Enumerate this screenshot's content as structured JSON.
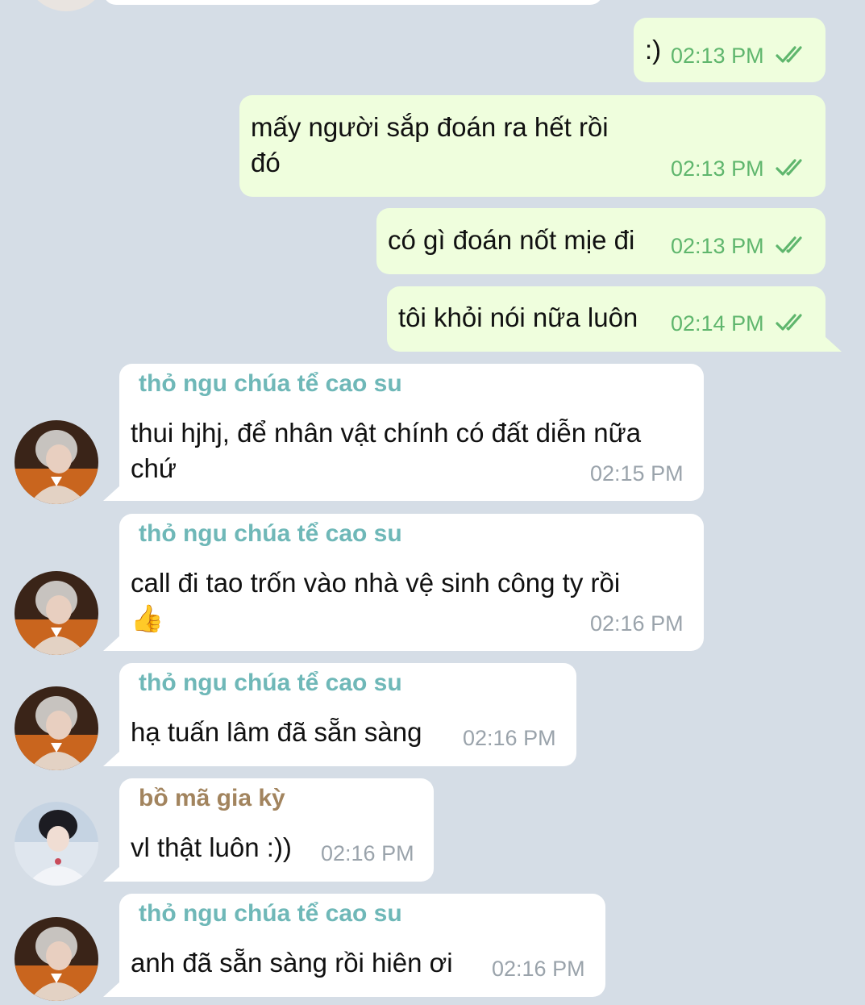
{
  "colors": {
    "background": "#d5dde6",
    "outgoing_bubble": "#effedd",
    "incoming_bubble": "#ffffff",
    "read_check": "#5fb66d",
    "sender_tho": "#6fb8b8",
    "sender_bo": "#a2845e"
  },
  "outgoing": [
    {
      "text": ":)",
      "time": "02:13 PM",
      "status": "read-double-check-icon"
    },
    {
      "text_lines": [
        "mấy người sắp đoán ra hết rồi",
        "đó"
      ],
      "time": "02:13 PM",
      "status": "read-double-check-icon"
    },
    {
      "text": "có gì đoán nốt mịe đi",
      "time": "02:13 PM",
      "status": "read-double-check-icon"
    },
    {
      "text": "tôi khỏi nói nữa luôn",
      "time": "02:14 PM",
      "status": "read-double-check-icon"
    }
  ],
  "incoming": [
    {
      "sender": "thỏ ngu chúa tể cao su",
      "text_lines": [
        "thui hjhj, để nhân vật chính có đất diễn nữa",
        "chứ"
      ],
      "time": "02:15 PM",
      "avatar": "user-avatar-tho"
    },
    {
      "sender": "thỏ ngu chúa tể cao su",
      "text_lines": [
        "call đi tao trốn vào nhà vệ sinh công ty rồi",
        "👍"
      ],
      "time": "02:16 PM",
      "avatar": "user-avatar-tho"
    },
    {
      "sender": "thỏ ngu chúa tể cao su",
      "text": "hạ tuấn lâm đã sẵn sàng",
      "time": "02:16 PM",
      "avatar": "user-avatar-tho"
    },
    {
      "sender": "bồ mã gia kỳ",
      "text": "vl thật luôn :))",
      "time": "02:16 PM",
      "avatar": "user-avatar-bo"
    },
    {
      "sender": "thỏ ngu chúa tể cao su",
      "text": "anh đã sẵn sàng rồi hiên ơi",
      "time": "02:16 PM",
      "avatar": "user-avatar-tho"
    }
  ]
}
